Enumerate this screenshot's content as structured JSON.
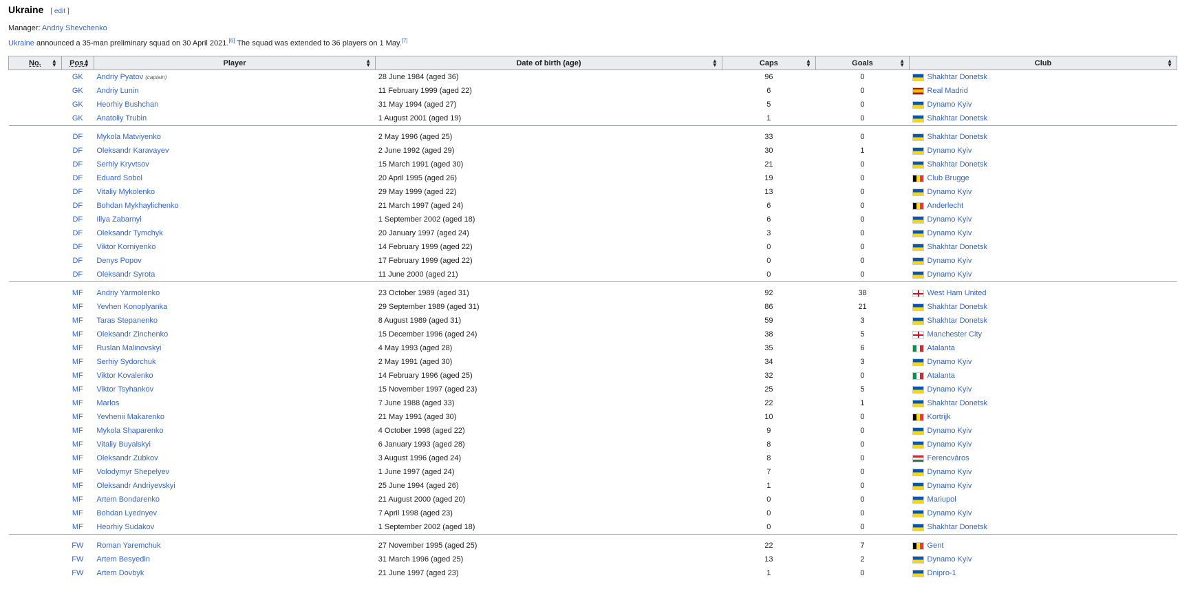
{
  "heading": {
    "title": "Ukraine",
    "edit_open": "[ ",
    "edit_label": "edit",
    "edit_close": " ]"
  },
  "manager": {
    "label": "Manager: ",
    "name": "Andriy Shevchenko"
  },
  "intro": {
    "country_link": "Ukraine",
    "text1": " announced a 35-man preliminary squad on 30 April 2021.",
    "ref1": "[6]",
    "text2": " The squad was extended to 36 players on 1 May.",
    "ref2": "[7]"
  },
  "table": {
    "headers": {
      "no": "No.",
      "pos": "Pos.",
      "player": "Player",
      "dob": "Date of birth (age)",
      "caps": "Caps",
      "goals": "Goals",
      "club": "Club"
    },
    "sort_icon": "sort-icon",
    "captain_note": "(captain)",
    "groups": [
      {
        "rows": [
          {
            "pos": "GK",
            "player": "Andriy Pyatov",
            "captain": true,
            "dob": "28 June 1984 (aged 36)",
            "caps": "96",
            "goals": "0",
            "flag": "ua",
            "club": "Shakhtar Donetsk"
          },
          {
            "pos": "GK",
            "player": "Andriy Lunin",
            "dob": "11 February 1999 (aged 22)",
            "caps": "6",
            "goals": "0",
            "flag": "es",
            "club": "Real Madrid"
          },
          {
            "pos": "GK",
            "player": "Heorhiy Bushchan",
            "dob": "31 May 1994 (aged 27)",
            "caps": "5",
            "goals": "0",
            "flag": "ua",
            "club": "Dynamo Kyiv"
          },
          {
            "pos": "GK",
            "player": "Anatoliy Trubin",
            "dob": "1 August 2001 (aged 19)",
            "caps": "1",
            "goals": "0",
            "flag": "ua",
            "club": "Shakhtar Donetsk"
          }
        ]
      },
      {
        "rows": [
          {
            "pos": "DF",
            "player": "Mykola Matviyenko",
            "dob": "2 May 1996 (aged 25)",
            "caps": "33",
            "goals": "0",
            "flag": "ua",
            "club": "Shakhtar Donetsk"
          },
          {
            "pos": "DF",
            "player": "Oleksandr Karavayev",
            "dob": "2 June 1992 (aged 29)",
            "caps": "30",
            "goals": "1",
            "flag": "ua",
            "club": "Dynamo Kyiv"
          },
          {
            "pos": "DF",
            "player": "Serhiy Kryvtsov",
            "dob": "15 March 1991 (aged 30)",
            "caps": "21",
            "goals": "0",
            "flag": "ua",
            "club": "Shakhtar Donetsk"
          },
          {
            "pos": "DF",
            "player": "Eduard Sobol",
            "dob": "20 April 1995 (aged 26)",
            "caps": "19",
            "goals": "0",
            "flag": "be",
            "club": "Club Brugge"
          },
          {
            "pos": "DF",
            "player": "Vitaliy Mykolenko",
            "dob": "29 May 1999 (aged 22)",
            "caps": "13",
            "goals": "0",
            "flag": "ua",
            "club": "Dynamo Kyiv"
          },
          {
            "pos": "DF",
            "player": "Bohdan Mykhaylichenko",
            "dob": "21 March 1997 (aged 24)",
            "caps": "6",
            "goals": "0",
            "flag": "be",
            "club": "Anderlecht"
          },
          {
            "pos": "DF",
            "player": "Illya Zabarnyi",
            "dob": "1 September 2002 (aged 18)",
            "caps": "6",
            "goals": "0",
            "flag": "ua",
            "club": "Dynamo Kyiv"
          },
          {
            "pos": "DF",
            "player": "Oleksandr Tymchyk",
            "dob": "20 January 1997 (aged 24)",
            "caps": "3",
            "goals": "0",
            "flag": "ua",
            "club": "Dynamo Kyiv"
          },
          {
            "pos": "DF",
            "player": "Viktor Korniyenko",
            "dob": "14 February 1999 (aged 22)",
            "caps": "0",
            "goals": "0",
            "flag": "ua",
            "club": "Shakhtar Donetsk"
          },
          {
            "pos": "DF",
            "player": "Denys Popov",
            "dob": "17 February 1999 (aged 22)",
            "caps": "0",
            "goals": "0",
            "flag": "ua",
            "club": "Dynamo Kyiv"
          },
          {
            "pos": "DF",
            "player": "Oleksandr Syrota",
            "dob": "11 June 2000 (aged 21)",
            "caps": "0",
            "goals": "0",
            "flag": "ua",
            "club": "Dynamo Kyiv"
          }
        ]
      },
      {
        "rows": [
          {
            "pos": "MF",
            "player": "Andriy Yarmolenko",
            "dob": "23 October 1989 (aged 31)",
            "caps": "92",
            "goals": "38",
            "flag": "en",
            "club": "West Ham United"
          },
          {
            "pos": "MF",
            "player": "Yevhen Konoplyanka",
            "dob": "29 September 1989 (aged 31)",
            "caps": "86",
            "goals": "21",
            "flag": "ua",
            "club": "Shakhtar Donetsk"
          },
          {
            "pos": "MF",
            "player": "Taras Stepanenko",
            "dob": "8 August 1989 (aged 31)",
            "caps": "59",
            "goals": "3",
            "flag": "ua",
            "club": "Shakhtar Donetsk"
          },
          {
            "pos": "MF",
            "player": "Oleksandr Zinchenko",
            "dob": "15 December 1996 (aged 24)",
            "caps": "38",
            "goals": "5",
            "flag": "en",
            "club": "Manchester City"
          },
          {
            "pos": "MF",
            "player": "Ruslan Malinovskyi",
            "dob": "4 May 1993 (aged 28)",
            "caps": "35",
            "goals": "6",
            "flag": "it",
            "club": "Atalanta"
          },
          {
            "pos": "MF",
            "player": "Serhiy Sydorchuk",
            "dob": "2 May 1991 (aged 30)",
            "caps": "34",
            "goals": "3",
            "flag": "ua",
            "club": "Dynamo Kyiv"
          },
          {
            "pos": "MF",
            "player": "Viktor Kovalenko",
            "dob": "14 February 1996 (aged 25)",
            "caps": "32",
            "goals": "0",
            "flag": "it",
            "club": "Atalanta"
          },
          {
            "pos": "MF",
            "player": "Viktor Tsyhankov",
            "dob": "15 November 1997 (aged 23)",
            "caps": "25",
            "goals": "5",
            "flag": "ua",
            "club": "Dynamo Kyiv"
          },
          {
            "pos": "MF",
            "player": "Marlos",
            "dob": "7 June 1988 (aged 33)",
            "caps": "22",
            "goals": "1",
            "flag": "ua",
            "club": "Shakhtar Donetsk"
          },
          {
            "pos": "MF",
            "player": "Yevhenii Makarenko",
            "dob": "21 May 1991 (aged 30)",
            "caps": "10",
            "goals": "0",
            "flag": "be",
            "club": "Kortrijk"
          },
          {
            "pos": "MF",
            "player": "Mykola Shaparenko",
            "dob": "4 October 1998 (aged 22)",
            "caps": "9",
            "goals": "0",
            "flag": "ua",
            "club": "Dynamo Kyiv"
          },
          {
            "pos": "MF",
            "player": "Vitaliy Buyalskyi",
            "dob": "6 January 1993 (aged 28)",
            "caps": "8",
            "goals": "0",
            "flag": "ua",
            "club": "Dynamo Kyiv"
          },
          {
            "pos": "MF",
            "player": "Oleksandr Zubkov",
            "dob": "3 August 1996 (aged 24)",
            "caps": "8",
            "goals": "0",
            "flag": "hu",
            "club": "Ferencváros"
          },
          {
            "pos": "MF",
            "player": "Volodymyr Shepelyev",
            "dob": "1 June 1997 (aged 24)",
            "caps": "7",
            "goals": "0",
            "flag": "ua",
            "club": "Dynamo Kyiv"
          },
          {
            "pos": "MF",
            "player": "Oleksandr Andriyevskyi",
            "dob": "25 June 1994 (aged 26)",
            "caps": "1",
            "goals": "0",
            "flag": "ua",
            "club": "Dynamo Kyiv"
          },
          {
            "pos": "MF",
            "player": "Artem Bondarenko",
            "dob": "21 August 2000 (aged 20)",
            "caps": "0",
            "goals": "0",
            "flag": "ua",
            "club": "Mariupol"
          },
          {
            "pos": "MF",
            "player": "Bohdan Lyednyev",
            "dob": "7 April 1998 (aged 23)",
            "caps": "0",
            "goals": "0",
            "flag": "ua",
            "club": "Dynamo Kyiv"
          },
          {
            "pos": "MF",
            "player": "Heorhiy Sudakov",
            "dob": "1 September 2002 (aged 18)",
            "caps": "0",
            "goals": "0",
            "flag": "ua",
            "club": "Shakhtar Donetsk"
          }
        ]
      },
      {
        "rows": [
          {
            "pos": "FW",
            "player": "Roman Yaremchuk",
            "dob": "27 November 1995 (aged 25)",
            "caps": "22",
            "goals": "7",
            "flag": "be",
            "club": "Gent"
          },
          {
            "pos": "FW",
            "player": "Artem Besyedin",
            "dob": "31 March 1996 (aged 25)",
            "caps": "13",
            "goals": "2",
            "flag": "ua",
            "club": "Dynamo Kyiv"
          },
          {
            "pos": "FW",
            "player": "Artem Dovbyk",
            "dob": "21 June 1997 (aged 23)",
            "caps": "1",
            "goals": "0",
            "flag": "ua",
            "club": "Dnipro-1"
          }
        ]
      }
    ]
  }
}
